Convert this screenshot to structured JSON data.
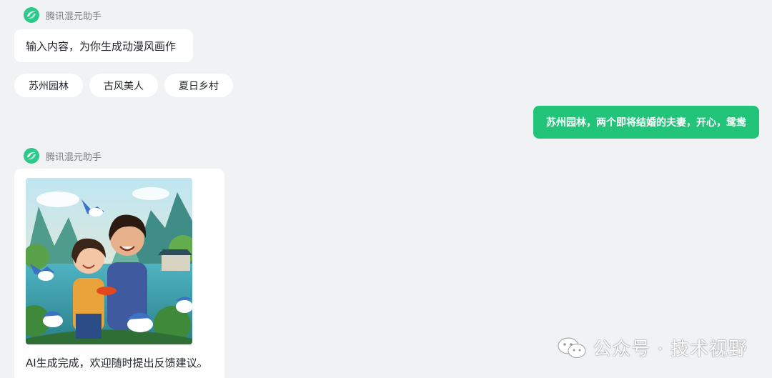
{
  "bot": {
    "name": "腾讯混元助手"
  },
  "intro": {
    "prompt": "输入内容，为你生成动漫风画作"
  },
  "suggestions": [
    "苏州园林",
    "古风美人",
    "夏日乡村"
  ],
  "user_message": "苏州园林，两个即将结婚的夫妻，开心，鸳鸯",
  "response": {
    "image_caption_icon": "generated-anime-image",
    "done_text": "AI生成完成，欢迎随时提出反馈建议。"
  },
  "watermark": {
    "text": "公众号 · 技术视野",
    "icon": "wechat-icon"
  },
  "colors": {
    "accent": "#22c47a",
    "background": "#f1f2f4",
    "bubble": "#ffffff"
  }
}
